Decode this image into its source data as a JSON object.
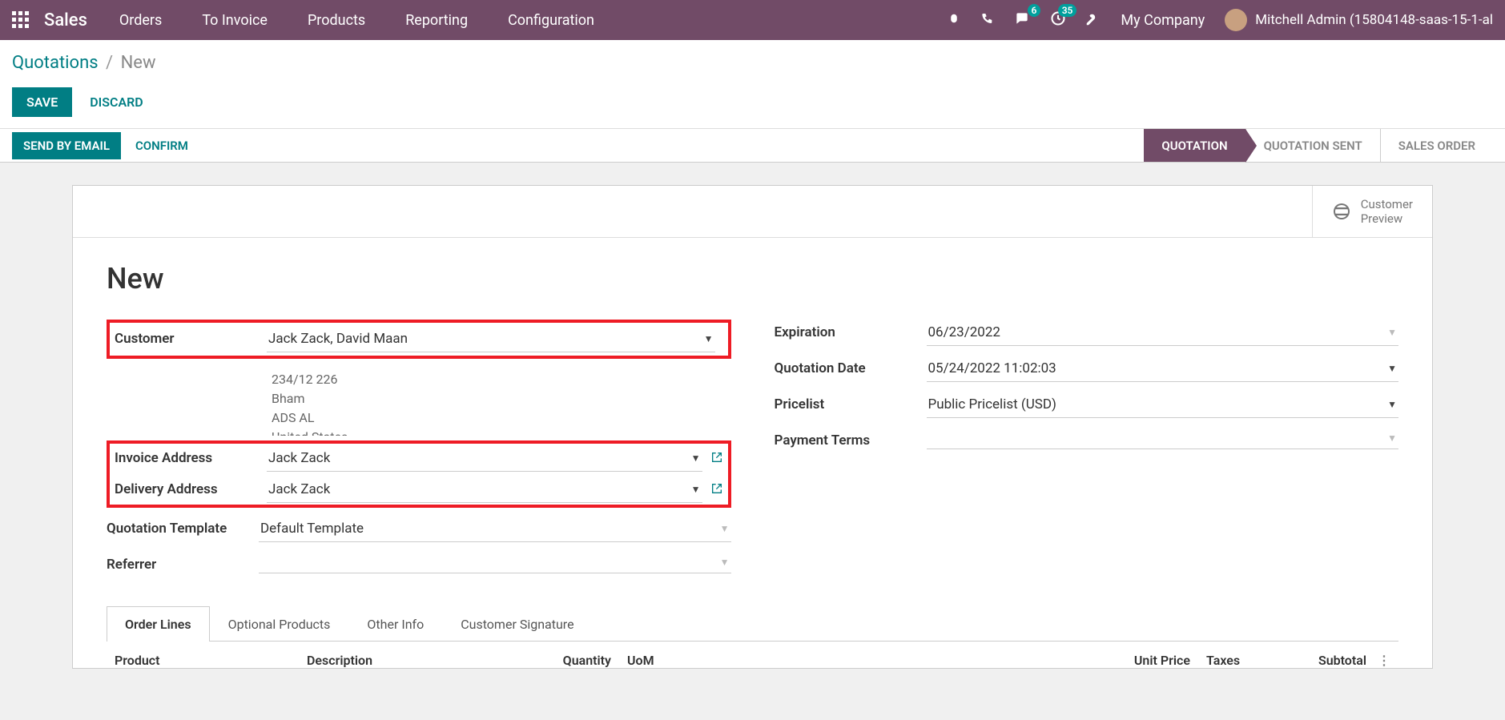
{
  "topnav": {
    "brand": "Sales",
    "menu": [
      "Orders",
      "To Invoice",
      "Products",
      "Reporting",
      "Configuration"
    ],
    "msg_badge": "6",
    "activity_badge": "35",
    "company": "My Company",
    "user": "Mitchell Admin (15804148-saas-15-1-al"
  },
  "breadcrumb": {
    "root": "Quotations",
    "sep": "/",
    "current": "New"
  },
  "buttons": {
    "save": "SAVE",
    "discard": "DISCARD",
    "send_email": "SEND BY EMAIL",
    "confirm": "CONFIRM"
  },
  "status_steps": {
    "quotation": "QUOTATION",
    "quotation_sent": "QUOTATION SENT",
    "sales_order": "SALES ORDER"
  },
  "stat_button": {
    "line1": "Customer",
    "line2": "Preview"
  },
  "title": "New",
  "fields_left": {
    "customer_label": "Customer",
    "customer_value": "Jack Zack, David Maan",
    "address": [
      "234/12 226",
      "Bham",
      "ADS AL",
      "United States"
    ],
    "invoice_label": "Invoice Address",
    "invoice_value": "Jack Zack",
    "delivery_label": "Delivery Address",
    "delivery_value": "Jack Zack",
    "template_label": "Quotation Template",
    "template_value": "Default Template",
    "referrer_label": "Referrer",
    "referrer_value": ""
  },
  "fields_right": {
    "expiration_label": "Expiration",
    "expiration_value": "06/23/2022",
    "quote_date_label": "Quotation Date",
    "quote_date_value": "05/24/2022 11:02:03",
    "pricelist_label": "Pricelist",
    "pricelist_value": "Public Pricelist (USD)",
    "payment_terms_label": "Payment Terms",
    "payment_terms_value": ""
  },
  "tabs": [
    "Order Lines",
    "Optional Products",
    "Other Info",
    "Customer Signature"
  ],
  "table_head": {
    "product": "Product",
    "description": "Description",
    "quantity": "Quantity",
    "uom": "UoM",
    "unit_price": "Unit Price",
    "taxes": "Taxes",
    "subtotal": "Subtotal"
  }
}
